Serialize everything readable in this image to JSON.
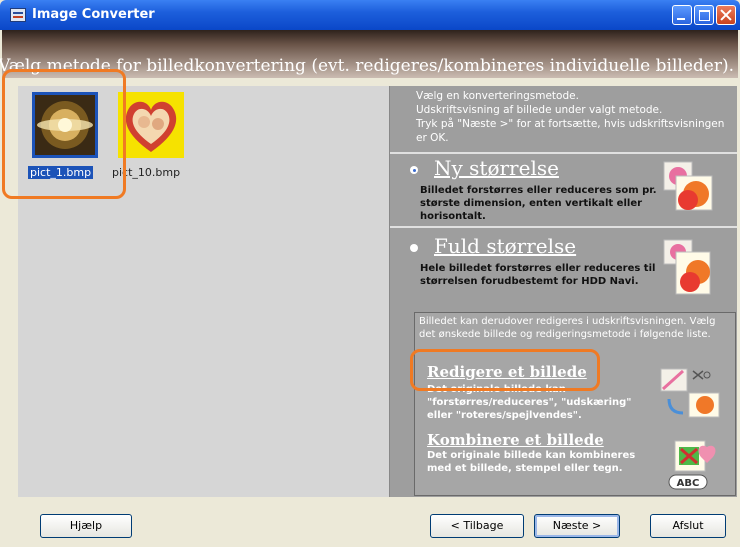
{
  "window": {
    "title": "Image Converter"
  },
  "banner": {
    "text": "Vælg  metode for billedkonvertering (evt. redigeres/kombineres individuelle billeder)."
  },
  "thumbnails": [
    {
      "label": "pict_1.bmp",
      "selected": true
    },
    {
      "label": "pict_10.bmp",
      "selected": false
    }
  ],
  "right": {
    "intro": "Vælg en konverteringsmetode.\nUdskriftsvisning af billede under valgt metode.\nTryk på \"Næste >\" for at fortsætte, hvis udskriftsvisningen er OK.",
    "options": [
      {
        "title": "Ny størrelse",
        "desc": "Billedet forstørres eller reduceres som pr. største dimension, enten vertikalt eller horisontalt.",
        "checked": true
      },
      {
        "title": "Fuld størrelse",
        "desc": "Hele billedet forstørres eller reduceres til størrelsen forudbestemt for HDD Navi.",
        "checked": false
      }
    ],
    "edit_intro": "Billedet kan derudover redigeres i udskriftsvisningen. Vælg det ønskede billede og redigeringsmetode i følgende liste.",
    "edit_link": {
      "title": "Redigere et billede",
      "desc": "Det originale billede kan \"forstørres/reduceres\", \"udskæring\" eller \"roteres/spejlvendes\"."
    },
    "combine_link": {
      "title": "Kombinere et billede",
      "desc": "Det originale billede kan kombineres med et billede, stempel eller tegn."
    },
    "abc_label": "ABC"
  },
  "buttons": {
    "help": "Hjælp",
    "back": "< Tilbage",
    "next": "Næste >",
    "quit": "Afslut"
  },
  "colors": {
    "titlebar": "#0a47c8",
    "annotation": "#f07a23",
    "selection": "#1c53b8"
  }
}
